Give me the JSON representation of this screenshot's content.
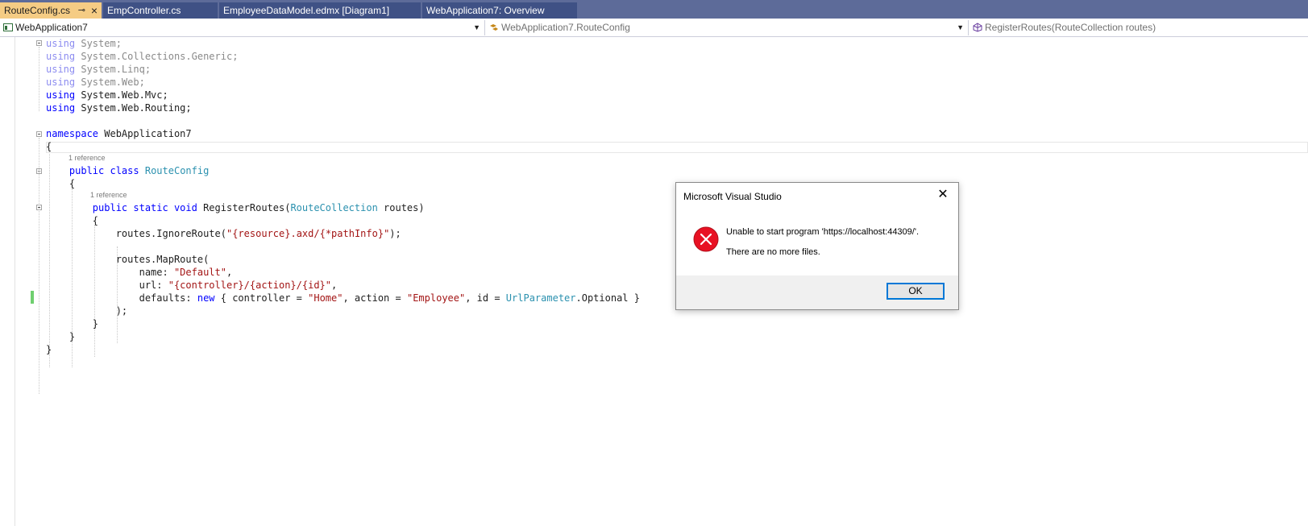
{
  "tabs": [
    {
      "label": "RouteConfig.cs",
      "active": true
    },
    {
      "label": "EmpController.cs",
      "active": false
    },
    {
      "label": "EmployeeDataModel.edmx [Diagram1]",
      "active": false
    },
    {
      "label": "WebApplication7: Overview",
      "active": false
    }
  ],
  "tab_icons": {
    "pin": "pin-icon",
    "close": "close-icon"
  },
  "navbar": {
    "project": "WebApplication7",
    "type": "WebApplication7.RouteConfig",
    "member": "RegisterRoutes(RouteCollection routes)"
  },
  "code": {
    "l1": {
      "kw": "using",
      "rest": " System;"
    },
    "l2": {
      "kw": "using",
      "rest": " System.Collections.Generic;"
    },
    "l3": {
      "kw": "using",
      "rest": " System.Linq;"
    },
    "l4": {
      "kw": "using",
      "rest": " System.Web;"
    },
    "l5": {
      "kw": "using",
      "rest": " System.Web.Mvc;"
    },
    "l6": {
      "kw": "using",
      "rest": " System.Web.Routing;"
    },
    "l8": {
      "kw": "namespace",
      "rest": " WebApplication7"
    },
    "l9": "{",
    "lens_class": "1 reference",
    "l10": {
      "kw": "public class",
      "type": "RouteConfig"
    },
    "l11": "{",
    "lens_method": "1 reference",
    "l12": {
      "kw": "public static void",
      "name": " RegisterRoutes(",
      "type": "RouteCollection",
      "rest": " routes)"
    },
    "l13": "{",
    "l14": {
      "pre": "routes.",
      "call": "IgnoreRoute",
      "open": "(",
      "str": "\"{resource}.axd/{*pathInfo}\"",
      "close": ");"
    },
    "l16": {
      "pre": "routes.",
      "call": "MapRoute",
      "rest": "("
    },
    "l17": {
      "pre": "name: ",
      "str": "\"Default\"",
      "rest": ","
    },
    "l18": {
      "pre": "url: ",
      "str": "\"{controller}/{action}/{id}\"",
      "rest": ","
    },
    "l19": {
      "pre": "defaults: ",
      "kw": "new",
      "a": " { controller = ",
      "s1": "\"Home\"",
      "b": ", action = ",
      "s2": "\"Employee\"",
      "c": ", id = ",
      "type": "UrlParameter",
      "d": ".Optional }"
    },
    "l20": ");",
    "l21": "}",
    "l22": "}",
    "l23": "}"
  },
  "dialog": {
    "title": "Microsoft Visual Studio",
    "message": "Unable to start program 'https://localhost:44309/'.",
    "detail": "There are no more files.",
    "ok_label": "OK",
    "icon": "error-icon",
    "error_color": "#e81123"
  }
}
